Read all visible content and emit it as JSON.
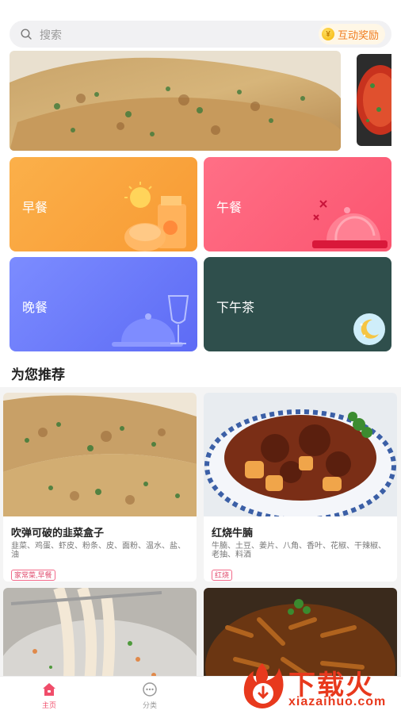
{
  "search": {
    "placeholder": "搜索",
    "reward_label": "互动奖励"
  },
  "categories": [
    {
      "label": "早餐",
      "color": "#f9a23d"
    },
    {
      "label": "午餐",
      "color": "#fc5d76"
    },
    {
      "label": "晚餐",
      "color": "#6573f7"
    },
    {
      "label": "下午茶",
      "color": "#2f4f4c"
    }
  ],
  "section": {
    "title": "为您推荐"
  },
  "recipes": [
    {
      "title": "吹弹可破的韭菜盒子",
      "ingredients": "韭菜、鸡蛋、虾皮、粉条、皮、面粉、温水、盐、油",
      "tag": "家常菜,早餐"
    },
    {
      "title": "红烧牛腩",
      "ingredients": "牛腩、土豆、姜片、八角、香叶、花椒、干辣椒、老抽、料酒",
      "tag": "红烧"
    },
    {
      "title": "",
      "ingredients": "",
      "tag": ""
    },
    {
      "title": "",
      "ingredients": "",
      "tag": ""
    }
  ],
  "tabbar": {
    "home_label": "主页",
    "category_label": "分类"
  },
  "watermark": {
    "title": "下载火",
    "url": "xiazaihuo.com"
  },
  "colors": {
    "accent": "#f04d6a",
    "reward": "#f07c1e",
    "watermark": "#e8391d"
  }
}
